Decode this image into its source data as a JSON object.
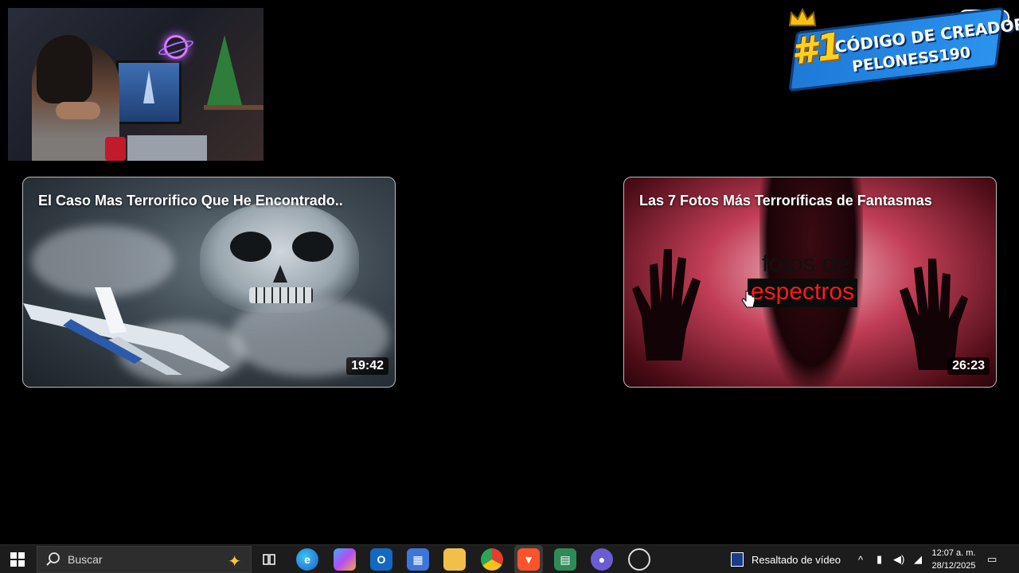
{
  "badge": {
    "number": "#1",
    "line1": "CÓDIGO DE CREADOR:",
    "line2": "PELONESS190"
  },
  "videos": [
    {
      "title": "El Caso Mas Terrorifico Que He Encontrado..",
      "duration": "19:42"
    },
    {
      "title": "Las 7 Fotos Más Terroríficas de Fantasmas",
      "duration": "26:23",
      "caption_line1": "fotos de",
      "caption_line2": "espectros"
    }
  ],
  "taskbar": {
    "search_label": "Buscar",
    "tray_label": "Resaltado de vídeo",
    "time": "12:07 a. m.",
    "date": "28/12/2025",
    "icons": [
      "windows-start-icon",
      "task-view-icon",
      "edge-icon",
      "copilot-icon",
      "outlook-icon",
      "store-icon",
      "file-explorer-icon",
      "chrome-icon",
      "brave-icon",
      "xbox-game-bar-icon",
      "obs-icon",
      "clock-app-icon"
    ]
  }
}
